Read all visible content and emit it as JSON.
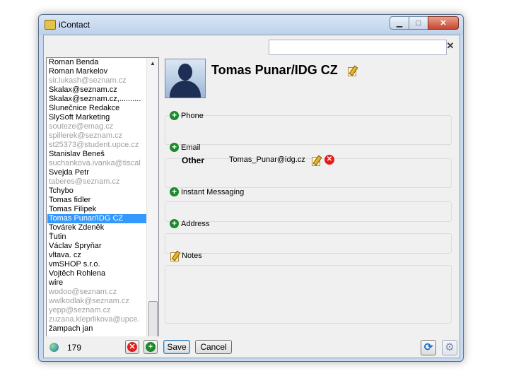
{
  "window": {
    "title": "iContact"
  },
  "search": {
    "placeholder": "",
    "value": ""
  },
  "contacts": [
    {
      "name": "Roman Benda",
      "gray": false
    },
    {
      "name": "Roman Markelov",
      "gray": false
    },
    {
      "name": "sir.lukash@seznam.cz",
      "gray": true
    },
    {
      "name": "Skalax@seznam.cz",
      "gray": false
    },
    {
      "name": "Skalax@seznam.cz,..........",
      "gray": false
    },
    {
      "name": "Slunečnice Redakce",
      "gray": false
    },
    {
      "name": "SlySoft Marketing",
      "gray": false
    },
    {
      "name": "souteze@emag.cz",
      "gray": true
    },
    {
      "name": "spillerek@seznam.cz",
      "gray": true
    },
    {
      "name": "st25373@student.upce.cz",
      "gray": true
    },
    {
      "name": "Stanislav Beneš",
      "gray": false
    },
    {
      "name": "suchankova.ivanka@tiscal",
      "gray": true
    },
    {
      "name": "Svejda Petr",
      "gray": false
    },
    {
      "name": "taberes@seznam.cz",
      "gray": true
    },
    {
      "name": "Tchybo",
      "gray": false
    },
    {
      "name": "Tomas fidler",
      "gray": false
    },
    {
      "name": "Tomas Filipek",
      "gray": false
    },
    {
      "name": "Tomas Punar/IDG CZ",
      "gray": false,
      "selected": true
    },
    {
      "name": "Továrek Zdeněk",
      "gray": false
    },
    {
      "name": "Ťutin",
      "gray": false
    },
    {
      "name": "Václav Špryňar",
      "gray": false
    },
    {
      "name": "vltava. cz",
      "gray": false
    },
    {
      "name": "vmSHOP s.r.o.",
      "gray": false
    },
    {
      "name": "Vojtěch Rohlena",
      "gray": false
    },
    {
      "name": "wire",
      "gray": false
    },
    {
      "name": "wodoo@seznam.cz",
      "gray": true
    },
    {
      "name": "wwlkodlak@seznam.cz",
      "gray": true
    },
    {
      "name": "yepp@seznam.cz",
      "gray": true
    },
    {
      "name": "zuzana.kleprlikova@upce.",
      "gray": true
    },
    {
      "name": "žampach jan",
      "gray": false
    }
  ],
  "detail": {
    "name": "Tomas Punar/IDG CZ",
    "sections": {
      "phone": "Phone",
      "email": "Email",
      "im": "Instant Messaging",
      "address": "Address",
      "notes": "Notes"
    },
    "email": {
      "type": "Other",
      "value": "Tomas_Punar@idg.cz"
    }
  },
  "footer": {
    "count": "179",
    "save_label": "Save",
    "cancel_label": "Cancel"
  }
}
